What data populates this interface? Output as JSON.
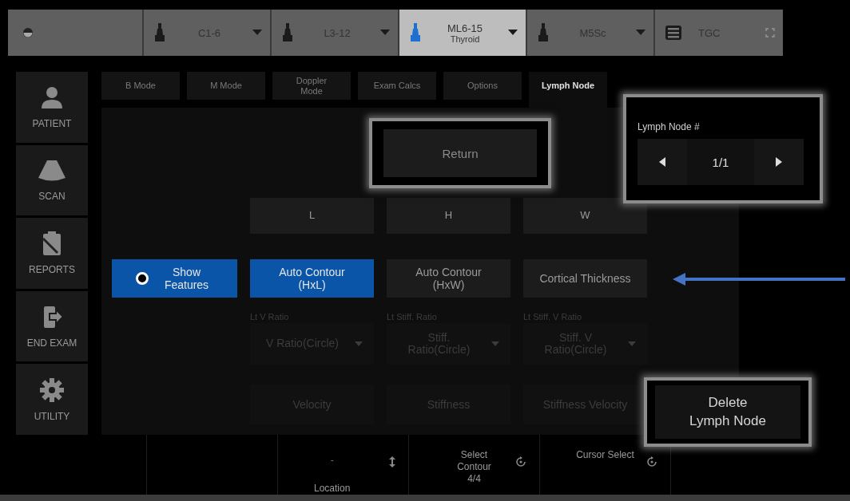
{
  "top_bar": [
    {
      "kind": "status"
    },
    {
      "kind": "probe",
      "label": "C1-6",
      "selected": false
    },
    {
      "kind": "probe",
      "label": "L3-12",
      "selected": false
    },
    {
      "kind": "probe",
      "label": "ML6-15",
      "sublabel": "Thyroid",
      "selected": true
    },
    {
      "kind": "probe",
      "label": "M5Sc",
      "selected": false
    },
    {
      "kind": "tgc",
      "label": "TGC"
    }
  ],
  "sidebar": {
    "items": [
      {
        "label": "PATIENT",
        "kind": "person"
      },
      {
        "label": "SCAN",
        "kind": "scan"
      },
      {
        "label": "REPORTS",
        "kind": "clipboard"
      },
      {
        "label": "END EXAM",
        "kind": "exit"
      },
      {
        "label": "UTILITY",
        "kind": "gear"
      }
    ]
  },
  "tabs": [
    {
      "label": "B Mode",
      "selected": false
    },
    {
      "label": "M Mode",
      "selected": false
    },
    {
      "label": "Doppler\nMode",
      "selected": false
    },
    {
      "label": "Exam Calcs",
      "selected": false
    },
    {
      "label": "Options",
      "selected": false
    },
    {
      "label": "Lymph Node",
      "selected": true
    }
  ],
  "panel": {
    "return_button": "Return",
    "measure_buttons": [
      {
        "label": "L"
      },
      {
        "label": "H"
      },
      {
        "label": "W"
      }
    ],
    "feature_row": [
      {
        "kind": "radio",
        "label": "Show\nFeatures",
        "on": true
      },
      {
        "kind": "button",
        "label": "Auto Contour\n(HxL)",
        "selected": true
      },
      {
        "kind": "button",
        "label": "Auto Contour\n(HxW)",
        "selected": false
      },
      {
        "kind": "button",
        "label": "Cortical Thickness",
        "selected": false
      }
    ],
    "ratio_dropdowns": [
      {
        "caption": "Lt V Ratio",
        "value": "V Ratio(Circle)",
        "disabled": true
      },
      {
        "caption": "Lt Stiff. Ratio",
        "value": "Stiff.\nRatio(Circle)",
        "disabled": true
      },
      {
        "caption": "Lt Stiff. V Ratio",
        "value": "Stiff. V\nRatio(Circle)",
        "disabled": true
      }
    ],
    "elasto_buttons": [
      {
        "label": "Velocity",
        "disabled": true
      },
      {
        "label": "Stiffness",
        "disabled": true
      },
      {
        "label": "Stiffness Velocity",
        "disabled": true
      }
    ],
    "lymph_node_number": {
      "label": "Lymph Node #",
      "value": "1/1"
    },
    "delete_button": "Delete\nLymph Node"
  },
  "bottom_bar": [
    {
      "kind": "empty"
    },
    {
      "kind": "empty"
    },
    {
      "kind": "slider",
      "value": "-",
      "label": "Location"
    },
    {
      "kind": "knob",
      "label": "Select\nContour\n4/4"
    },
    {
      "kind": "knob",
      "label": "Cursor Select"
    },
    {
      "kind": "empty"
    }
  ]
}
